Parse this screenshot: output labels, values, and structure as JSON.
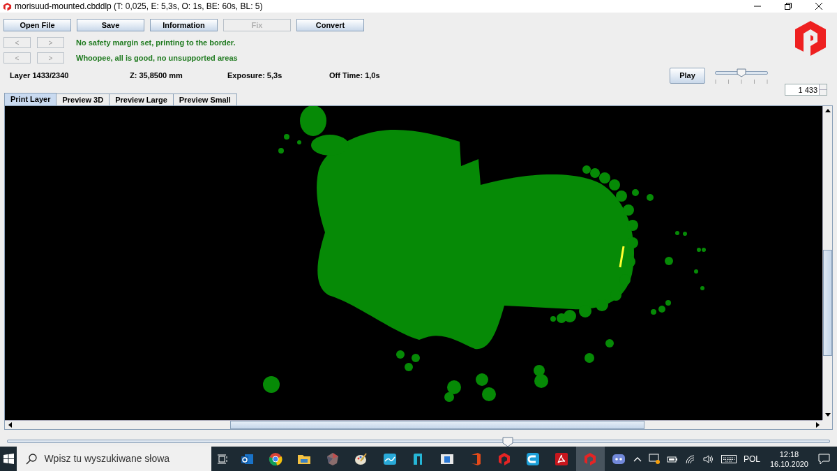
{
  "window": {
    "title": "morisuud-mounted.cbddlp (T: 0,025, E: 5,3s, O: 1s, BE: 60s, BL: 5)"
  },
  "toolbar": [
    {
      "label": "Open File",
      "disabled": false
    },
    {
      "label": "Save",
      "disabled": false
    },
    {
      "label": "Information",
      "disabled": false
    },
    {
      "label": "Fix",
      "disabled": true
    },
    {
      "label": "Convert",
      "disabled": false
    }
  ],
  "messages": [
    {
      "prev": "<",
      "next": ">",
      "text": "No safety margin set, printing to the border."
    },
    {
      "prev": "<",
      "next": ">",
      "text": "Whoopee, all is good, no unsupported areas"
    }
  ],
  "info": {
    "layer_label": "Layer",
    "layer": "1433/2340",
    "z": "Z: 35,8500 mm",
    "exposure": "Exposure: 5,3s",
    "off_time": "Off Time: 1,0s"
  },
  "play": {
    "label": "Play"
  },
  "speed_slider": {
    "level": 0.5
  },
  "layer_spinner": {
    "value": "1 433"
  },
  "tabs": [
    {
      "label": "Print Layer",
      "selected": true
    },
    {
      "label": "Preview 3D",
      "selected": false
    },
    {
      "label": "Preview Large",
      "selected": false
    },
    {
      "label": "Preview Small",
      "selected": false
    }
  ],
  "layer_slider": {
    "level": 0.61
  },
  "taskbar": {
    "search_placeholder": "Wpisz tu wyszukiwane słowa",
    "apps": [
      {
        "kind": "mail",
        "active": false
      },
      {
        "kind": "browser",
        "active": false
      },
      {
        "kind": "folder",
        "active": false
      },
      {
        "kind": "gem",
        "active": false
      },
      {
        "kind": "palette",
        "active": false
      },
      {
        "kind": "wave",
        "active": false
      },
      {
        "kind": "arch",
        "active": false
      },
      {
        "kind": "window",
        "active": false
      },
      {
        "kind": "office",
        "active": false
      },
      {
        "kind": "hexagon",
        "active": false
      },
      {
        "kind": "cura",
        "active": false
      },
      {
        "kind": "pdf",
        "active": false
      },
      {
        "kind": "hexagon",
        "active": true
      },
      {
        "kind": "chat",
        "active": false
      }
    ],
    "language": "POL",
    "time": "12:18",
    "date": "16.10.2020"
  }
}
